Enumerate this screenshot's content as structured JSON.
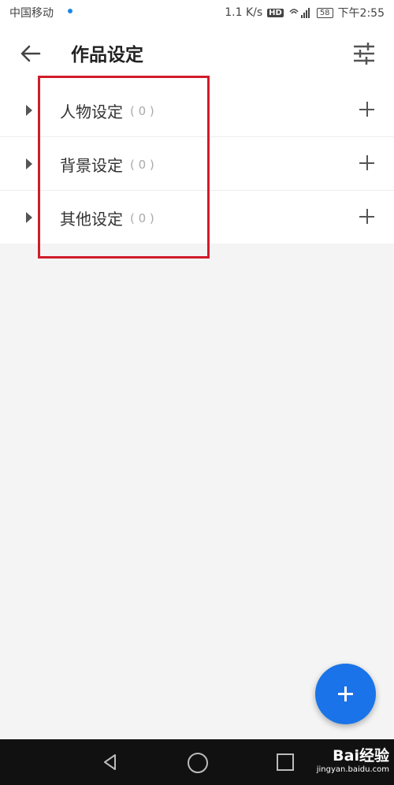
{
  "status_bar": {
    "carrier": "中国移动",
    "speed": "1.1 K/s",
    "hd": "HD",
    "network": "4G",
    "battery": "58",
    "time": "下午2:55"
  },
  "header": {
    "title": "作品设定",
    "back_icon": "arrow-left-icon",
    "filter_icon": "sliders-icon"
  },
  "settings": [
    {
      "label": "人物设定",
      "count": "( 0 )"
    },
    {
      "label": "背景设定",
      "count": "( 0 )"
    },
    {
      "label": "其他设定",
      "count": "( 0 )"
    }
  ],
  "fab_icon": "plus-icon",
  "colors": {
    "accent": "#1a73e8",
    "highlight": "#d01c2a"
  },
  "watermark": {
    "logo": "Bai经验",
    "url": "jingyan.baidu.com"
  }
}
